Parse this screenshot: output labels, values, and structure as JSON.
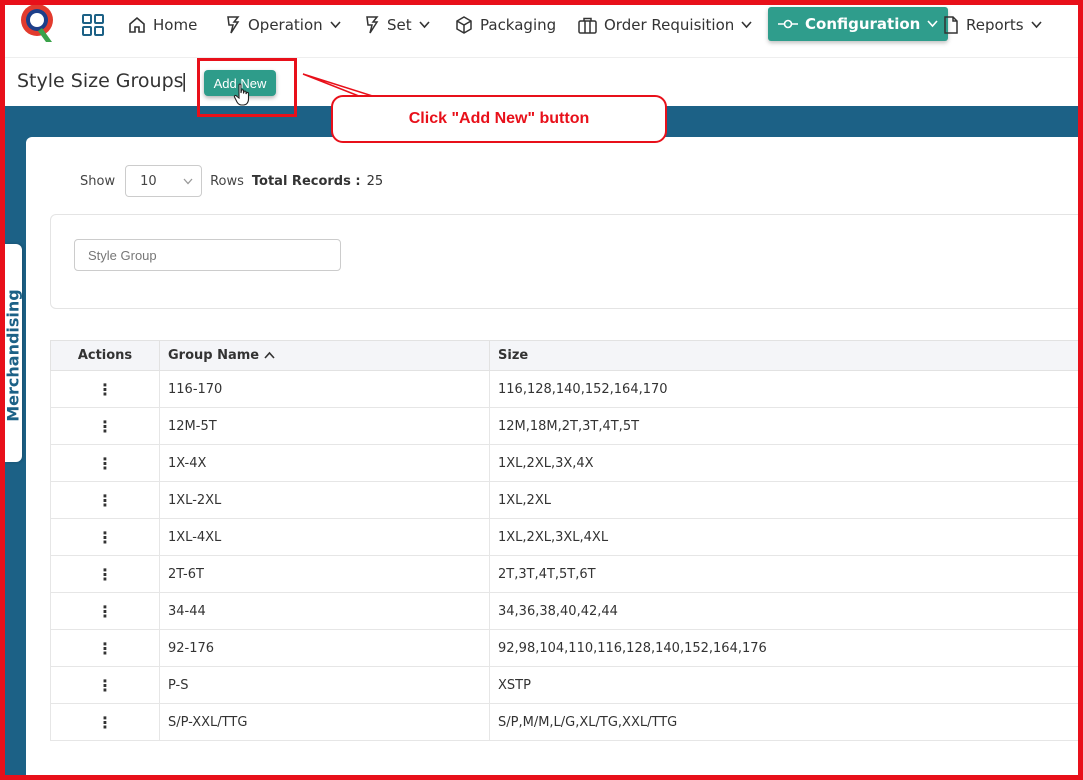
{
  "nav": {
    "home": "Home",
    "operation": "Operation",
    "set": "Set",
    "packaging": "Packaging",
    "order_requisition": "Order Requisition",
    "configuration": "Configuration",
    "reports": "Reports"
  },
  "page": {
    "title": "Style Size Groups",
    "separator": "|",
    "add_new": "Add New"
  },
  "annotation": {
    "callout": "Click \"Add New\" button"
  },
  "side_tab": "Merchandising",
  "list": {
    "show_label": "Show",
    "rows_value": "10",
    "rows_label": "Rows",
    "total_label": "Total Records :",
    "total_value": "25",
    "filter_placeholder": "Style Group"
  },
  "table": {
    "headers": {
      "actions": "Actions",
      "group": "Group Name",
      "size": "Size"
    },
    "rows": [
      {
        "action": "⋮",
        "group": "116-170",
        "size": "116,128,140,152,164,170"
      },
      {
        "action": "⋮",
        "group": "12M-5T",
        "size": "12M,18M,2T,3T,4T,5T"
      },
      {
        "action": "⋮",
        "group": "1X-4X",
        "size": "1XL,2XL,3X,4X"
      },
      {
        "action": "⋮",
        "group": "1XL-2XL",
        "size": "1XL,2XL"
      },
      {
        "action": "⋮",
        "group": "1XL-4XL",
        "size": "1XL,2XL,3XL,4XL"
      },
      {
        "action": "⋮",
        "group": "2T-6T",
        "size": "2T,3T,4T,5T,6T"
      },
      {
        "action": "⋮",
        "group": "34-44",
        "size": "34,36,38,40,42,44"
      },
      {
        "action": "⋮",
        "group": "92-176",
        "size": "92,98,104,110,116,128,140,152,164,176"
      },
      {
        "action": "⋮",
        "group": "P-S",
        "size": "XSTP"
      },
      {
        "action": "⋮",
        "group": "S/P-XXL/TTG",
        "size": "S/P,M/M,L/G,XL/TG,XXL/TTG"
      }
    ]
  },
  "colors": {
    "accent": "#2f9d8c",
    "band": "#1c6186",
    "annotation": "#e8101a"
  }
}
